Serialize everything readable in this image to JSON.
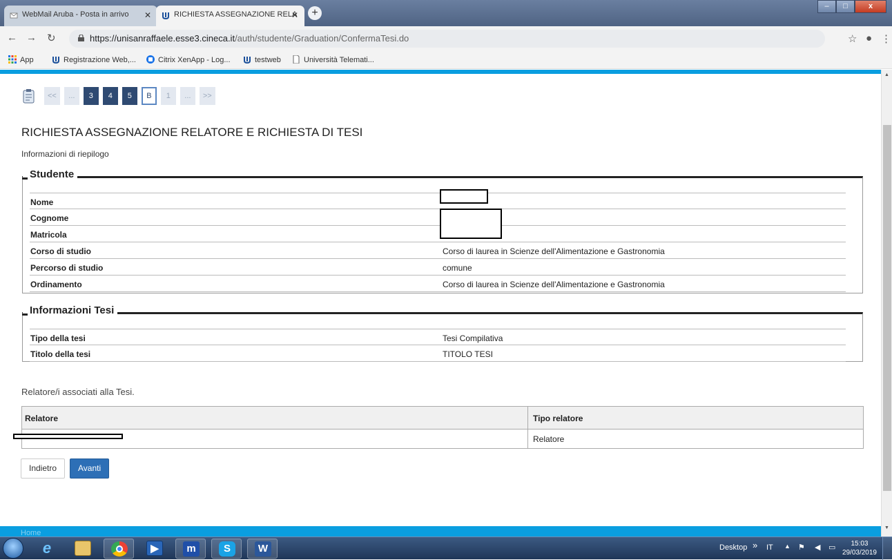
{
  "browser": {
    "tabs": [
      {
        "label": "WebMail Aruba - Posta in arrivo",
        "active": false
      },
      {
        "label": "RICHIESTA ASSEGNAZIONE RELA",
        "active": true
      }
    ],
    "url_host": "https://unisanraffaele.esse3.cineca.it",
    "url_path": "/auth/studente/Graduation/ConfermaTesi.do",
    "bookmarks": [
      "App",
      "Registrazione Web,...",
      "Citrix XenApp - Log...",
      "testweb",
      "Università Telemati..."
    ]
  },
  "steps": [
    "<<",
    "...",
    "3",
    "4",
    "5",
    "B",
    "1",
    "...",
    ">>"
  ],
  "page": {
    "title": "RICHIESTA ASSEGNAZIONE RELATORE E RICHIESTA DI TESI",
    "subtitle": "Informazioni di riepilogo"
  },
  "studente": {
    "legend": "Studente",
    "rows": [
      {
        "label": "Nome",
        "value": ""
      },
      {
        "label": "Cognome",
        "value": ""
      },
      {
        "label": "Matricola",
        "value": ""
      },
      {
        "label": "Corso di studio",
        "value": "Corso di laurea in Scienze dell'Alimentazione e Gastronomia"
      },
      {
        "label": "Percorso di studio",
        "value": "comune"
      },
      {
        "label": "Ordinamento",
        "value": "Corso di laurea in Scienze dell'Alimentazione e Gastronomia"
      }
    ]
  },
  "tesi": {
    "legend": "Informazioni Tesi",
    "rows": [
      {
        "label": "Tipo della tesi",
        "value": "Tesi Compilativa"
      },
      {
        "label": "Titolo della tesi",
        "value": "TITOLO TESI"
      }
    ]
  },
  "relatori": {
    "heading": "Relatore/i associati alla Tesi.",
    "col_relatore": "Relatore",
    "col_tipo": "Tipo relatore",
    "rows": [
      {
        "relatore": "",
        "tipo": "Relatore"
      }
    ]
  },
  "buttons": {
    "back": "Indietro",
    "next": "Avanti"
  },
  "footer": {
    "label": "Home"
  },
  "taskbar": {
    "desktop": "Desktop",
    "lang": "IT",
    "time": "15:03",
    "date": "29/03/2019"
  }
}
